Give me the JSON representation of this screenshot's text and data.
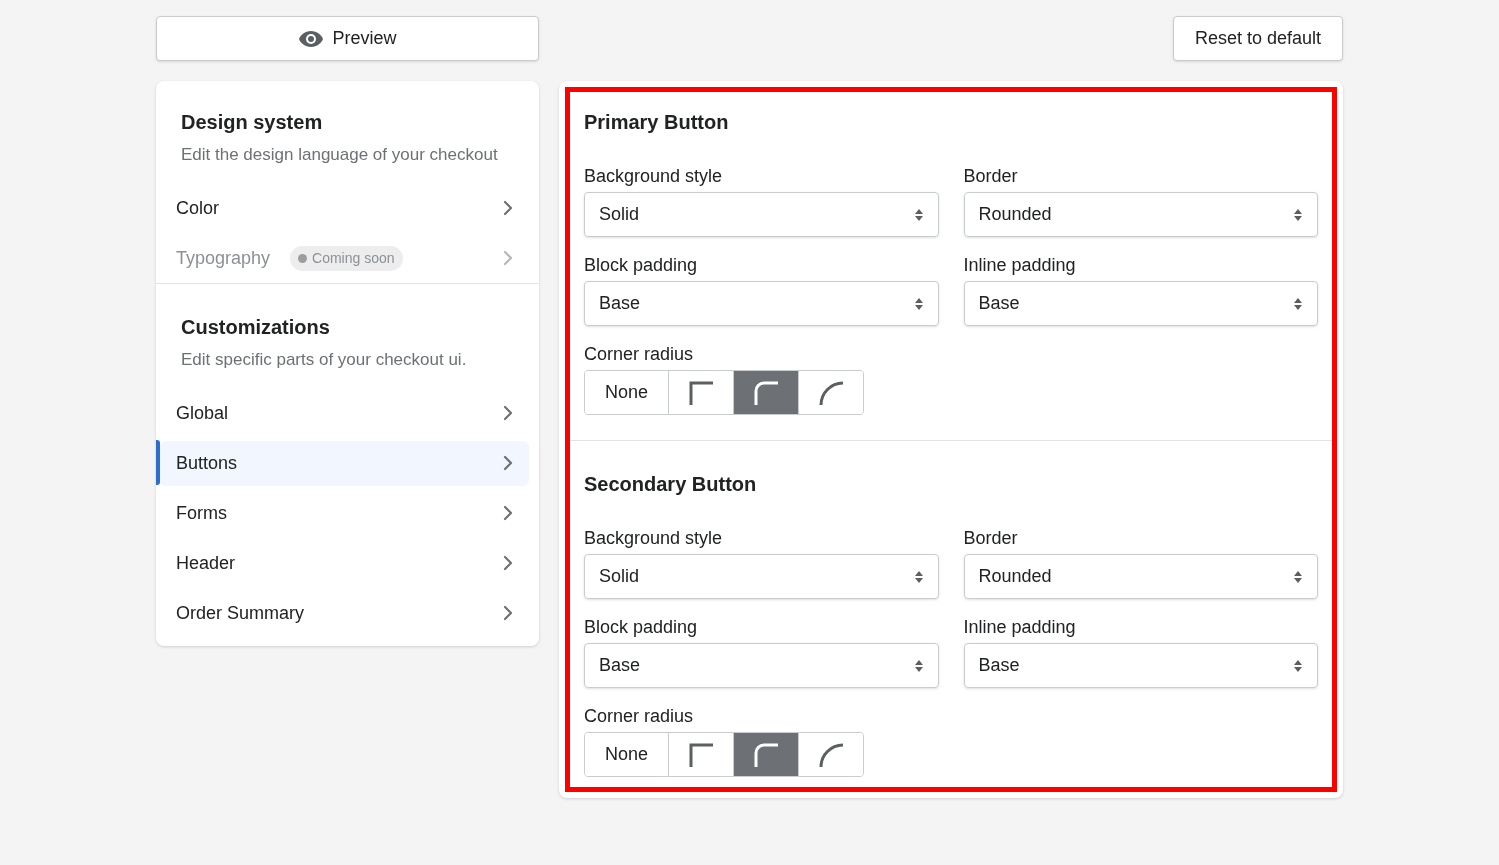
{
  "preview_button": {
    "label": "Preview"
  },
  "reset_button": {
    "label": "Reset to default"
  },
  "sidebar": {
    "sections": [
      {
        "title": "Design system",
        "subtitle": "Edit the design language of your checkout",
        "items": [
          {
            "label": "Color",
            "selected": false,
            "disabled": false
          },
          {
            "label": "Typography",
            "selected": false,
            "disabled": true,
            "badge": "Coming soon"
          }
        ]
      },
      {
        "title": "Customizations",
        "subtitle": "Edit specific parts of your checkout ui.",
        "items": [
          {
            "label": "Global",
            "selected": false,
            "disabled": false
          },
          {
            "label": "Buttons",
            "selected": true,
            "disabled": false
          },
          {
            "label": "Forms",
            "selected": false,
            "disabled": false
          },
          {
            "label": "Header",
            "selected": false,
            "disabled": false
          },
          {
            "label": "Order Summary",
            "selected": false,
            "disabled": false
          }
        ]
      }
    ]
  },
  "panel": {
    "highlighted": true,
    "sections": [
      {
        "title": "Primary Button",
        "fields": [
          {
            "label": "Background style",
            "value": "Solid"
          },
          {
            "label": "Border",
            "value": "Rounded"
          },
          {
            "label": "Block padding",
            "value": "Base"
          },
          {
            "label": "Inline padding",
            "value": "Base"
          }
        ],
        "corner_radius": {
          "label": "Corner radius",
          "options": [
            {
              "kind": "text",
              "label": "None",
              "selected": false
            },
            {
              "kind": "square",
              "selected": false
            },
            {
              "kind": "rounded",
              "selected": true
            },
            {
              "kind": "round",
              "selected": false
            }
          ]
        }
      },
      {
        "title": "Secondary Button",
        "fields": [
          {
            "label": "Background style",
            "value": "Solid"
          },
          {
            "label": "Border",
            "value": "Rounded"
          },
          {
            "label": "Block padding",
            "value": "Base"
          },
          {
            "label": "Inline padding",
            "value": "Base"
          }
        ],
        "corner_radius": {
          "label": "Corner radius",
          "options": [
            {
              "kind": "text",
              "label": "None",
              "selected": false
            },
            {
              "kind": "square",
              "selected": false
            },
            {
              "kind": "rounded",
              "selected": true
            },
            {
              "kind": "round",
              "selected": false
            }
          ]
        }
      }
    ]
  }
}
